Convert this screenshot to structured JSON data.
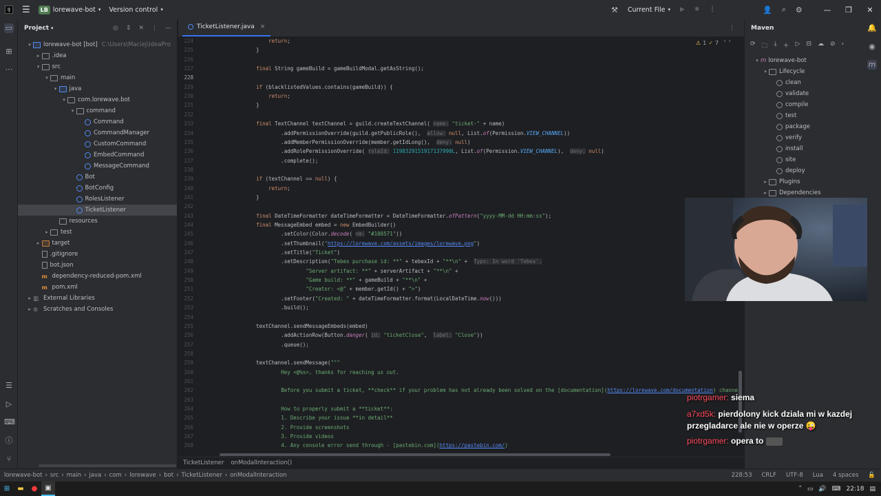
{
  "titlebar": {
    "project_badge": "LB",
    "project_name": "lorewave-bot",
    "vcs": "Version control",
    "run_config": "Current File"
  },
  "project_panel": {
    "title": "Project",
    "tree": [
      {
        "label": "lorewave-bot [bot]",
        "extra": "C:\\Users\\Maciej\\IdeaPro",
        "depth": 0,
        "type": "folder-blue",
        "open": true
      },
      {
        "label": ".idea",
        "depth": 1,
        "type": "folder",
        "open": false
      },
      {
        "label": "src",
        "depth": 1,
        "type": "folder",
        "open": true
      },
      {
        "label": "main",
        "depth": 2,
        "type": "folder",
        "open": true
      },
      {
        "label": "java",
        "depth": 3,
        "type": "folder-blue",
        "open": true
      },
      {
        "label": "com.lorewave.bot",
        "depth": 4,
        "type": "folder",
        "open": true
      },
      {
        "label": "command",
        "depth": 5,
        "type": "folder",
        "open": true
      },
      {
        "label": "Command",
        "depth": 6,
        "type": "class"
      },
      {
        "label": "CommandManager",
        "depth": 6,
        "type": "class"
      },
      {
        "label": "CustomCommand",
        "depth": 6,
        "type": "class"
      },
      {
        "label": "EmbedCommand",
        "depth": 6,
        "type": "class"
      },
      {
        "label": "MessageCommand",
        "depth": 6,
        "type": "class"
      },
      {
        "label": "Bot",
        "depth": 5,
        "type": "class"
      },
      {
        "label": "BotConfig",
        "depth": 5,
        "type": "class"
      },
      {
        "label": "RolesListener",
        "depth": 5,
        "type": "class"
      },
      {
        "label": "TicketListener",
        "depth": 5,
        "type": "class",
        "selected": true
      },
      {
        "label": "resources",
        "depth": 3,
        "type": "folder"
      },
      {
        "label": "test",
        "depth": 2,
        "type": "folder",
        "open": false
      },
      {
        "label": "target",
        "depth": 1,
        "type": "folder-orange",
        "open": false
      },
      {
        "label": ".gitignore",
        "depth": 1,
        "type": "file"
      },
      {
        "label": "bot.json",
        "depth": 1,
        "type": "file"
      },
      {
        "label": "dependency-reduced-pom.xml",
        "depth": 1,
        "type": "xml"
      },
      {
        "label": "pom.xml",
        "depth": 1,
        "type": "xml"
      },
      {
        "label": "External Libraries",
        "depth": 0,
        "type": "lib",
        "open": false
      },
      {
        "label": "Scratches and Consoles",
        "depth": 0,
        "type": "scratch",
        "open": false
      }
    ]
  },
  "editor": {
    "tab": "TicketListener.java",
    "inspection": "1",
    "inspection_warn": "7",
    "current_line": "228",
    "lines": [
      {
        "n": "224",
        "html": "        <span class='kw'>return</span>;"
      },
      {
        "n": "225",
        "html": "    }"
      },
      {
        "n": "226",
        "html": ""
      },
      {
        "n": "227",
        "html": "    <span class='kw'>final</span> String gameBuild = gameBuildModal.getAsString();"
      },
      {
        "n": "228",
        "html": ""
      },
      {
        "n": "229",
        "html": "    <span class='kw'>if</span> (blacklistedValues.contains(gameBuild)) {"
      },
      {
        "n": "230",
        "html": "        <span class='kw'>return</span>;"
      },
      {
        "n": "231",
        "html": "    }"
      },
      {
        "n": "232",
        "html": ""
      },
      {
        "n": "233",
        "html": "    <span class='kw'>final</span> TextChannel textChannel = guild.createTextChannel( <span class='hint'>name:</span> <span class='str'>\"ticket-\"</span> + name)"
      },
      {
        "n": "234",
        "html": "            .addPermissionOverride(guild.getPublicRole(),  <span class='hint'>allow:</span> <span class='kw'>null</span>, List.<span class='it'>of</span>(Permission.<span class='st'>VIEW_CHANNEL</span>))"
      },
      {
        "n": "235",
        "html": "            .addMemberPermissionOverride(member.getIdLong(),  <span class='hint'>deny:</span> <span class='kw'>null</span>)"
      },
      {
        "n": "236",
        "html": "            .addRolePermissionOverride( <span class='hint'>roleId:</span> <span class='num'>1198329151917137990L</span>, List.<span class='it'>of</span>(Permission.<span class='st'>VIEW_CHANNEL</span>),  <span class='hint'>deny:</span> <span class='kw'>null</span>)"
      },
      {
        "n": "237",
        "html": "            .complete();"
      },
      {
        "n": "238",
        "html": ""
      },
      {
        "n": "239",
        "html": "    <span class='kw'>if</span> (textChannel == <span class='kw'>null</span>) {"
      },
      {
        "n": "240",
        "html": "        <span class='kw'>return</span>;"
      },
      {
        "n": "241",
        "html": "    }"
      },
      {
        "n": "242",
        "html": ""
      },
      {
        "n": "243",
        "html": "    <span class='kw'>final</span> DateTimeFormatter dateTimeFormatter = DateTimeFormatter.<span class='it'>ofPattern</span>(<span class='str'>\"yyyy-MM-dd HH:mm:ss\"</span>);"
      },
      {
        "n": "244",
        "html": "    <span class='kw'>final</span> MessageEmbed embed = <span class='kw'>new</span> EmbedBuilder()"
      },
      {
        "n": "245",
        "html": "            .setColor(Color.<span class='it'>decode</span>( <span class='hint'>nm:</span> <span class='str'>\"#108571\"</span>))"
      },
      {
        "n": "246",
        "html": "            .setThumbnail(<span class='str'>\"<span class='link'>https://lorewave.com/assets/images/lorewave.png</span>\"</span>)"
      },
      {
        "n": "247",
        "html": "            .setTitle(<span class='str'>\"Ticket\"</span>)"
      },
      {
        "n": "248",
        "html": "            .setDescription(<span class='str'>\"Tebex purchase id: **\"</span> + tebexId + <span class='str'>\"**\\n\"</span> +  <span class='hint'>Typo: In word 'Tebex'.</span>"
      },
      {
        "n": "249",
        "html": "                    <span class='str'>\"Server artifact: **\"</span> + serverArtifact + <span class='str'>\"**\\n\"</span> +"
      },
      {
        "n": "250",
        "html": "                    <span class='str'>\"Game build: **\"</span> + gameBuild + <span class='str'>\"**\\n\"</span> +"
      },
      {
        "n": "251",
        "html": "                    <span class='str'>\"Creator: &lt;@\"</span> + member.getId() + <span class='str'>\"&gt;\"</span>)"
      },
      {
        "n": "252",
        "html": "            .setFooter(<span class='str'>\"Created: \"</span> + dateTimeFormatter.format(LocalDateTime.<span class='it'>now</span>()))"
      },
      {
        "n": "253",
        "html": "            .build();"
      },
      {
        "n": "254",
        "html": ""
      },
      {
        "n": "255",
        "html": "    textChannel.sendMessageEmbeds(embed)"
      },
      {
        "n": "256",
        "html": "            .addActionRow(Button.<span class='it'>danger</span>( <span class='hint'>id:</span> <span class='str'>\"ticketClose\"</span>,  <span class='hint'>label:</span> <span class='str'>\"Close\"</span>))"
      },
      {
        "n": "257",
        "html": "            .queue();"
      },
      {
        "n": "258",
        "html": ""
      },
      {
        "n": "259",
        "html": "    textChannel.sendMessage(<span class='str'>\"\"\"</span>"
      },
      {
        "n": "260",
        "html": "            <span class='str'>Hey &lt;@%s&gt;, thanks for reaching us out.</span>"
      },
      {
        "n": "261",
        "html": ""
      },
      {
        "n": "262",
        "html": "            <span class='str'>Before you submit a ticket, **check** if your problem has not already been solved on the [documentation](<span class='link'>https://lorewave.com/documentation</span>) channe</span>"
      },
      {
        "n": "263",
        "html": ""
      },
      {
        "n": "264",
        "html": "            <span class='str'>How to properly submit a **ticket**:</span>"
      },
      {
        "n": "265",
        "html": "            <span class='str'>1. Describe your issue **in detail**</span>"
      },
      {
        "n": "266",
        "html": "            <span class='str'>2. Provide screenshots</span>"
      },
      {
        "n": "267",
        "html": "            <span class='str'>3. Provide videos</span>"
      },
      {
        "n": "268",
        "html": "            <span class='str'>4. Any console error send through - [pastebin.com](<span class='link'>https://pastebin.com/</span>)</span>"
      }
    ],
    "breadcrumb": [
      "TicketListener",
      "onModalInteraction()"
    ]
  },
  "maven": {
    "title": "Maven",
    "project": "lorewave-bot",
    "lifecycle": "Lifecycle",
    "goals": [
      "clean",
      "validate",
      "compile",
      "test",
      "package",
      "verify",
      "install",
      "site",
      "deploy"
    ],
    "plugins": "Plugins",
    "dependencies": "Dependencies"
  },
  "chat": [
    {
      "user": "piotrgamer:",
      "msg": "siema"
    },
    {
      "user": "a7xd5k:",
      "msg": "pierdolony kick dziala mi w kazdej przegladarce ale nie w operze 😜"
    },
    {
      "user": "piotrgamer:",
      "msg": "opera to"
    }
  ],
  "statusbar": {
    "path": [
      "lorewave-bot",
      "src",
      "main",
      "java",
      "com",
      "lorewave",
      "bot",
      "TicketListener",
      "onModalInteraction"
    ],
    "position": "228:53",
    "line_sep": "CRLF",
    "encoding": "UTF-8",
    "lang": "Lua",
    "indent": "4 spaces"
  },
  "taskbar": {
    "time": "22:18"
  }
}
